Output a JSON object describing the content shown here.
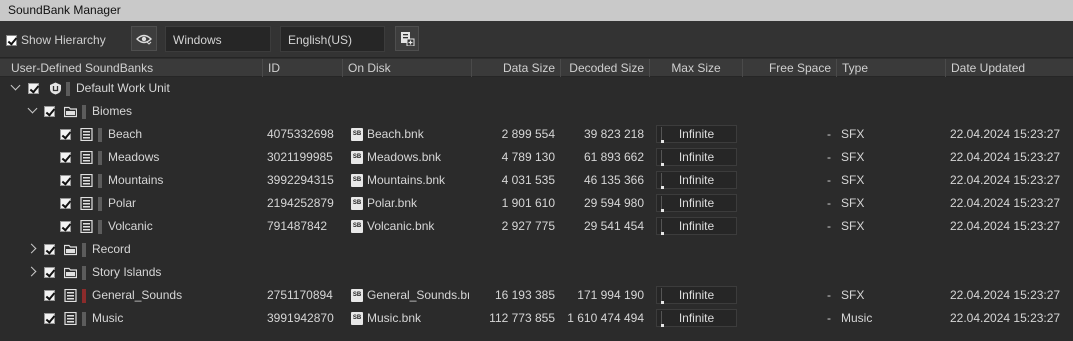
{
  "window": {
    "title": "SoundBank Manager"
  },
  "toolbar": {
    "show_hierarchy_label": "Show Hierarchy",
    "platform": "Windows",
    "language": "English(US)"
  },
  "columns": {
    "name": "User-Defined SoundBanks",
    "id": "ID",
    "on_disk": "On Disk",
    "data_size": "Data Size",
    "decoded_size": "Decoded Size",
    "max_size": "Max Size",
    "free_space": "Free Space",
    "type": "Type",
    "date_updated": "Date Updated"
  },
  "rows": [
    {
      "kind": "workunit",
      "name": "Default Work Unit"
    },
    {
      "kind": "folder",
      "name": "Biomes"
    },
    {
      "kind": "bank",
      "name": "Beach",
      "id": "4075332698",
      "file": "Beach.bnk",
      "data_size": "2 899 554",
      "decoded_size": "39 823 218",
      "max_size": "Infinite",
      "free_space": "-",
      "type": "SFX",
      "date": "22.04.2024 15:23:27"
    },
    {
      "kind": "bank",
      "name": "Meadows",
      "id": "3021199985",
      "file": "Meadows.bnk",
      "data_size": "4 789 130",
      "decoded_size": "61 893 662",
      "max_size": "Infinite",
      "free_space": "-",
      "type": "SFX",
      "date": "22.04.2024 15:23:27"
    },
    {
      "kind": "bank",
      "name": "Mountains",
      "id": "3992294315",
      "file": "Mountains.bnk",
      "data_size": "4 031 535",
      "decoded_size": "46 135 366",
      "max_size": "Infinite",
      "free_space": "-",
      "type": "SFX",
      "date": "22.04.2024 15:23:27"
    },
    {
      "kind": "bank",
      "name": "Polar",
      "id": "2194252879",
      "file": "Polar.bnk",
      "data_size": "1 901 610",
      "decoded_size": "29 594 980",
      "max_size": "Infinite",
      "free_space": "-",
      "type": "SFX",
      "date": "22.04.2024 15:23:27"
    },
    {
      "kind": "bank",
      "name": "Volcanic",
      "id": "791487842",
      "file": "Volcanic.bnk",
      "data_size": "2 927 775",
      "decoded_size": "29 541 454",
      "max_size": "Infinite",
      "free_space": "-",
      "type": "SFX",
      "date": "22.04.2024 15:23:27"
    },
    {
      "kind": "folder-collapsed",
      "name": "Record"
    },
    {
      "kind": "folder-collapsed",
      "name": "Story Islands"
    },
    {
      "kind": "bank-top",
      "name": "General_Sounds",
      "id": "2751170894",
      "file": "General_Sounds.bn",
      "data_size": "16 193 385",
      "decoded_size": "171 994 190",
      "max_size": "Infinite",
      "free_space": "-",
      "type": "SFX",
      "date": "22.04.2024 15:23:27",
      "marker_color": "#8b2b2b"
    },
    {
      "kind": "bank-top",
      "name": "Music",
      "id": "3991942870",
      "file": "Music.bnk",
      "data_size": "112 773 855",
      "decoded_size": "1 610 474 494",
      "max_size": "Infinite",
      "free_space": "-",
      "type": "Music",
      "date": "22.04.2024 15:23:27"
    }
  ]
}
